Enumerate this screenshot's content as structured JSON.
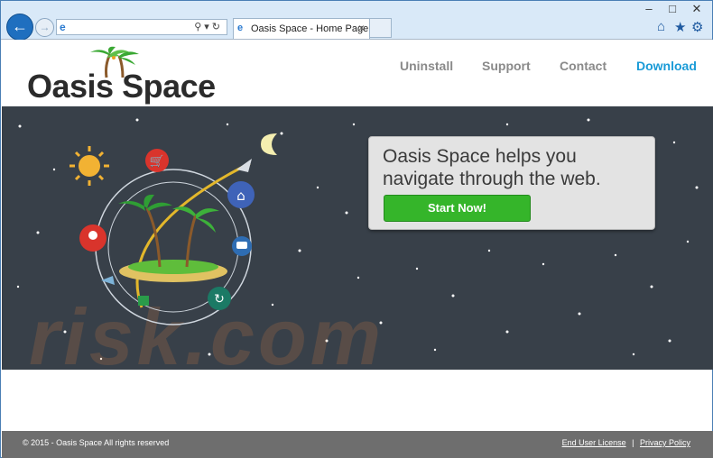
{
  "browser": {
    "window_controls": [
      "–",
      "□",
      "✕"
    ],
    "tab_title": "Oasis Space - Home Page",
    "address_value": "",
    "icons": [
      "back-arrow-icon",
      "forward-arrow-icon",
      "ie-icon",
      "search-icon",
      "refresh-icon",
      "home-icon",
      "favorites-star-icon",
      "settings-gear-icon"
    ]
  },
  "header": {
    "logo_text": "Oasis Space",
    "nav": [
      {
        "label": "Uninstall"
      },
      {
        "label": "Support"
      },
      {
        "label": "Contact"
      },
      {
        "label": "Download"
      }
    ]
  },
  "hero": {
    "headline_line1": "Oasis Space helps you",
    "headline_line2": "navigate through the web.",
    "start_button": "Start Now!",
    "watermark": "risk.com"
  },
  "footer": {
    "copyright": "© 2015 - Oasis Space All rights reserved",
    "eula": "End User License",
    "separator": "|",
    "privacy": "Privacy Policy"
  },
  "colors": {
    "hero_bg": "#384049",
    "download_link": "#1a9bd7",
    "start_button": "#35b52a",
    "footer_bg": "#6e6e6e"
  }
}
